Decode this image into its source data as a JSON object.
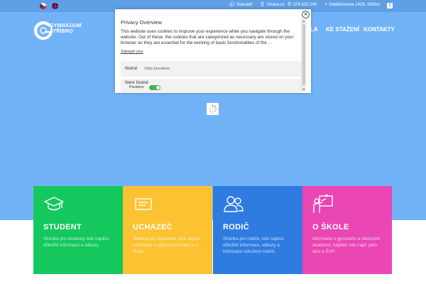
{
  "topbar": {
    "links": [
      {
        "label": "Bakaláři",
        "icon": "graduation-cap-icon"
      },
      {
        "label": "Strava.cz",
        "icon": "cutlery-icon"
      },
      {
        "label": "374 630 240",
        "icon": "phone-icon"
      },
      {
        "label": "Sobělslavova 1426, Stříbro",
        "icon": "location-pin-icon"
      }
    ],
    "social": {
      "label": "f",
      "icon": "facebook-icon"
    }
  },
  "logo": {
    "line1": "GYMNÁZIUM",
    "line2": "STŘÍBRO"
  },
  "nav": {
    "items": [
      "LA",
      "KE STAŽENÍ",
      "KONTAKTY"
    ]
  },
  "privacy": {
    "title": "Privacy Overview",
    "close": "×",
    "description": "This website uses cookies to improve your experience while you navigate through the website. Out of these, the cookies that are categorized as necessary are stored on your browser as they are essential for the working of basic functionalities of the ...",
    "more_link": "Zobrazit více",
    "categories": [
      {
        "label": "Nutné",
        "status": "Vždy povoleno"
      },
      {
        "label": "Není Nutné",
        "status": "Povoleno",
        "enabled": true
      }
    ]
  },
  "cards": [
    {
      "title": "STUDENT",
      "text": "Stránka pro studenty, kde najdou důležité informace a odkazy.",
      "color": "#14c85e",
      "icon": "graduation-cap-icon"
    },
    {
      "title": "UCHAZEČ",
      "text": "Stránka pro uchazeče, kde najdou informace o přijímacím řízení a o škole.",
      "color": "#fcc232",
      "icon": "diploma-icon"
    },
    {
      "title": "RODIČ",
      "text": "Stránka pro rodiče, kde najdou důležité informace, odkazy a informace sdružení rodičů.",
      "color": "#2e7ce0",
      "icon": "users-icon"
    },
    {
      "title": "O ŠKOLE",
      "text": "Informace o gymnáziu a obchodní akademii, najdete zde např. plán akcí a ŠVP.",
      "color": "#ea46b4",
      "icon": "teacher-board-icon"
    }
  ],
  "colors": {
    "hero": "#72b3f8",
    "topbar": "#5f9fe6"
  }
}
